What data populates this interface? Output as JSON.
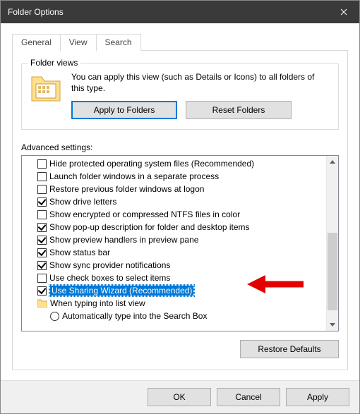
{
  "window": {
    "title": "Folder Options"
  },
  "tabs": {
    "general": "General",
    "view": "View",
    "search": "Search"
  },
  "folderViews": {
    "group_title": "Folder views",
    "help_text": "You can apply this view (such as Details or Icons) to all folders of this type.",
    "apply_btn": "Apply to Folders",
    "reset_btn": "Reset Folders"
  },
  "advanced": {
    "label": "Advanced settings:",
    "items": [
      {
        "label": "Hide protected operating system files (Recommended)",
        "checked": false
      },
      {
        "label": "Launch folder windows in a separate process",
        "checked": false
      },
      {
        "label": "Restore previous folder windows at logon",
        "checked": false
      },
      {
        "label": "Show drive letters",
        "checked": true
      },
      {
        "label": "Show encrypted or compressed NTFS files in color",
        "checked": false
      },
      {
        "label": "Show pop-up description for folder and desktop items",
        "checked": true
      },
      {
        "label": "Show preview handlers in preview pane",
        "checked": true
      },
      {
        "label": "Show status bar",
        "checked": true
      },
      {
        "label": "Show sync provider notifications",
        "checked": true
      },
      {
        "label": "Use check boxes to select items",
        "checked": false
      },
      {
        "label": "Use Sharing Wizard (Recommended)",
        "checked": true,
        "selected": true
      }
    ],
    "group_item": {
      "label": "When typing into list view"
    },
    "radio_item": {
      "label": "Automatically type into the Search Box",
      "selected": false
    },
    "restore_btn": "Restore Defaults"
  },
  "footer": {
    "ok": "OK",
    "cancel": "Cancel",
    "apply": "Apply"
  }
}
